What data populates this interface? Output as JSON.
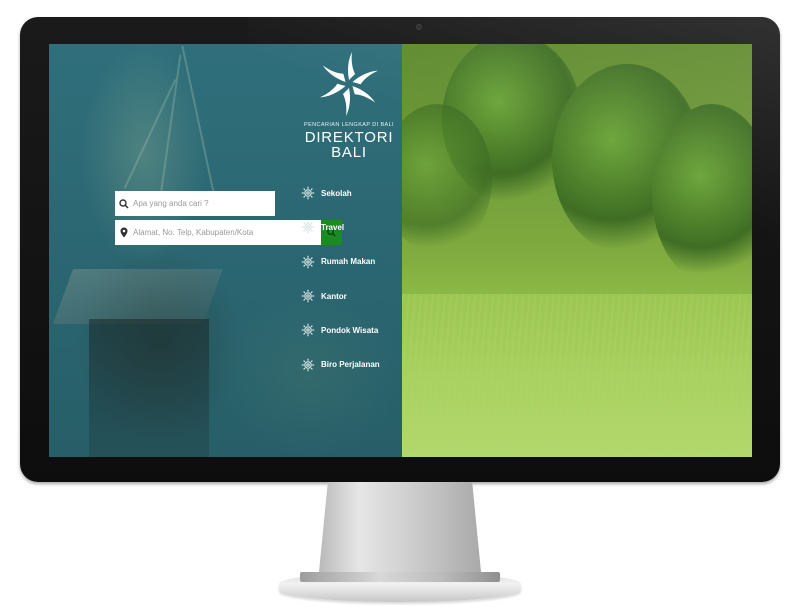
{
  "brand": {
    "tagline": "PENCARIAN LENGKAP DI BALI",
    "name_line1": "DIREKTORI",
    "name_line2": "BALI"
  },
  "search": {
    "keyword_placeholder": "Apa yang anda cari ?",
    "location_placeholder": "Alamat, No. Telp, Kabupaten/Kota",
    "search_icon": "search-icon",
    "location_icon": "map-pin-icon",
    "button_icon": "search-icon"
  },
  "menu": {
    "icon": "gear-icon",
    "items": [
      {
        "label": "Sekolah"
      },
      {
        "label": "Travel"
      },
      {
        "label": "Rumah Makan"
      },
      {
        "label": "Kantor"
      },
      {
        "label": "Pondok Wisata"
      },
      {
        "label": "Biro Perjalanan"
      }
    ]
  },
  "colors": {
    "panel_teal": "#2e6a75",
    "button_green": "#1a8a25",
    "text_white": "#ffffff"
  }
}
